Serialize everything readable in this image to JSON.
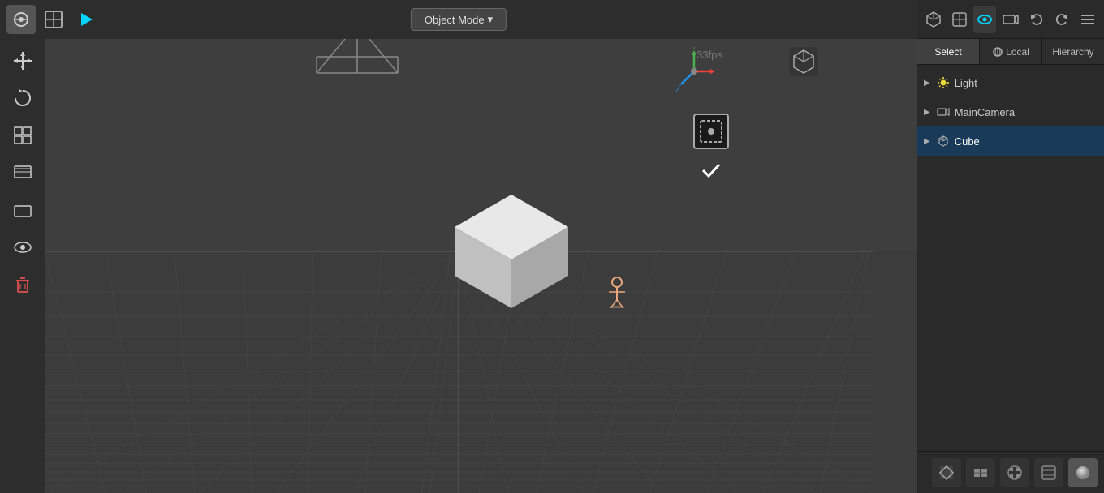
{
  "viewport": {
    "mode_label": "Object Mode",
    "fps": "33fps"
  },
  "toolbar": {
    "top_buttons": [
      {
        "name": "blender-logo",
        "icon": "🔷"
      },
      {
        "name": "viewport-shading",
        "icon": "⬜"
      },
      {
        "name": "play-button",
        "icon": "▶"
      }
    ]
  },
  "left_toolbar": {
    "buttons": [
      {
        "name": "move-tool",
        "icon": "✛"
      },
      {
        "name": "rotate-tool",
        "icon": "↺"
      },
      {
        "name": "transform-tool",
        "icon": "⊞"
      },
      {
        "name": "layer-tool",
        "icon": "▭"
      },
      {
        "name": "view-tool",
        "icon": "👁"
      },
      {
        "name": "delete-tool",
        "icon": "🗑",
        "danger": true
      }
    ]
  },
  "right_panel": {
    "icon_bar": [
      {
        "name": "gizmo-btn",
        "icon": "⊕"
      },
      {
        "name": "perspective-btn",
        "icon": "⬡"
      },
      {
        "name": "visible-btn",
        "icon": "👁",
        "active": true
      },
      {
        "name": "camera-btn",
        "icon": "🎥"
      },
      {
        "name": "undo-btn",
        "icon": "↩"
      },
      {
        "name": "redo-btn",
        "icon": "↪"
      },
      {
        "name": "menu-btn",
        "icon": "≡"
      }
    ],
    "context_bar": {
      "select_label": "Select",
      "local_label": "Local",
      "hierarchy_label": "Hierarchy"
    },
    "hierarchy_items": [
      {
        "id": "light",
        "label": "Light",
        "icon": "▶",
        "selected": false
      },
      {
        "id": "main-camera",
        "label": "MainCamera",
        "icon": "▶",
        "selected": false
      },
      {
        "id": "cube",
        "label": "Cube",
        "icon": "▶",
        "selected": true
      }
    ],
    "bottom_buttons": [
      {
        "name": "shading-1",
        "icon": "◼"
      },
      {
        "name": "shading-2",
        "icon": "⊞"
      },
      {
        "name": "shading-3",
        "icon": "⬡"
      },
      {
        "name": "shading-4",
        "icon": "⬡"
      },
      {
        "name": "shading-sphere",
        "icon": "⚪"
      }
    ]
  }
}
